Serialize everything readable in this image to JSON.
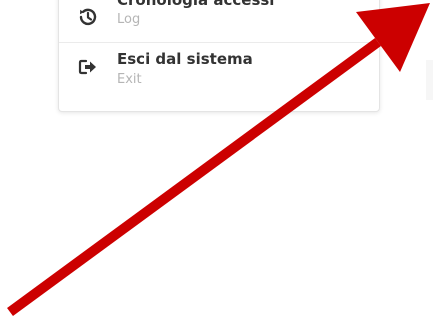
{
  "menu": {
    "items": [
      {
        "title": "Cronologia accessi",
        "subtitle": "Log",
        "icon": "history-icon"
      },
      {
        "title": "Esci dal sistema",
        "subtitle": "Exit",
        "icon": "logout-icon"
      }
    ]
  },
  "annotation": {
    "arrow_color": "#cc0000"
  }
}
